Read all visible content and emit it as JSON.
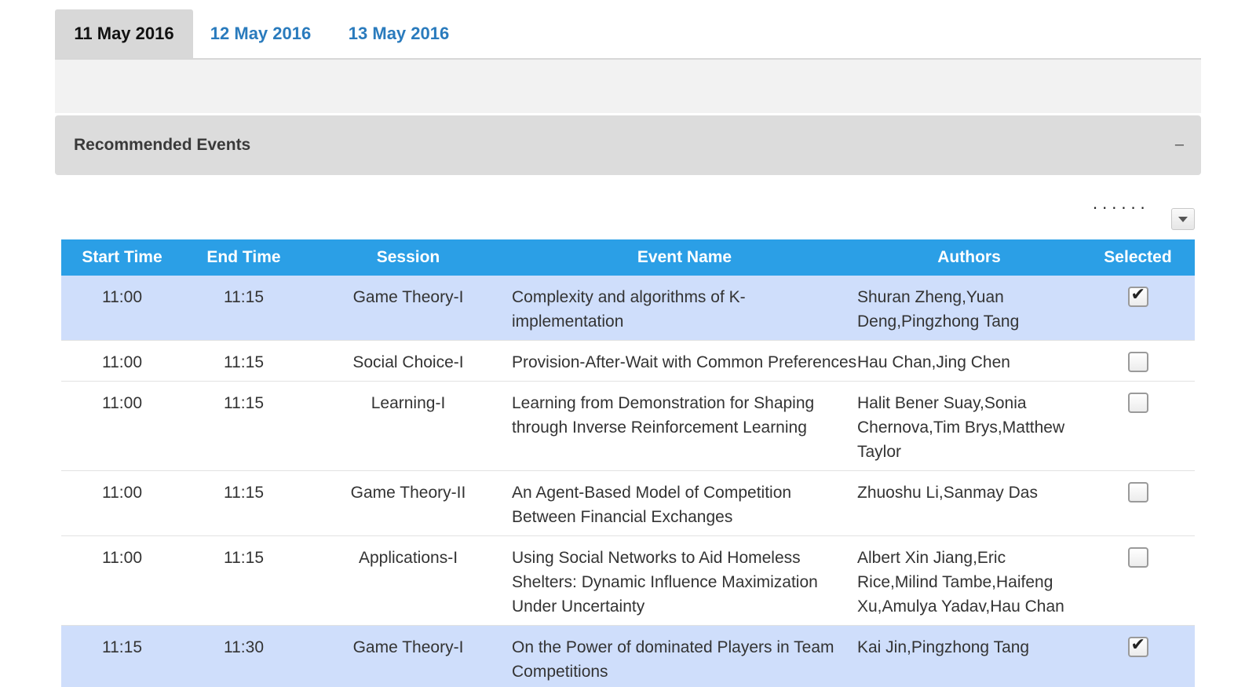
{
  "tabs": [
    {
      "label": "11 May 2016",
      "active": true
    },
    {
      "label": "12 May 2016",
      "active": false
    },
    {
      "label": "13 May 2016",
      "active": false
    }
  ],
  "panel": {
    "title": "Recommended Events",
    "collapse_symbol": "–",
    "more_symbol": "......"
  },
  "table": {
    "headers": {
      "start": "Start Time",
      "end": "End Time",
      "session": "Session",
      "event": "Event Name",
      "authors": "Authors",
      "selected": "Selected"
    },
    "rows": [
      {
        "start": "11:00",
        "end": "11:15",
        "session": "Game Theory-I",
        "event": "Complexity and algorithms of K-implementation",
        "authors": "Shuran Zheng,Yuan Deng,Pingzhong Tang",
        "selected": true
      },
      {
        "start": "11:00",
        "end": "11:15",
        "session": "Social Choice-I",
        "event": "Provision-After-Wait with Common Preferences",
        "authors": "Hau Chan,Jing Chen",
        "selected": false
      },
      {
        "start": "11:00",
        "end": "11:15",
        "session": "Learning-I",
        "event": "Learning from Demonstration for Shaping through Inverse Reinforcement Learning",
        "authors": "Halit Bener Suay,Sonia Chernova,Tim Brys,Matthew Taylor",
        "selected": false
      },
      {
        "start": "11:00",
        "end": "11:15",
        "session": "Game Theory-II",
        "event": "An Agent-Based Model of Competition Between Financial Exchanges",
        "authors": "Zhuoshu Li,Sanmay Das",
        "selected": false
      },
      {
        "start": "11:00",
        "end": "11:15",
        "session": "Applications-I",
        "event": "Using Social Networks to Aid Homeless Shelters: Dynamic Influence Maximization Under Uncertainty",
        "authors": "Albert Xin Jiang,Eric Rice,Milind Tambe,Haifeng Xu,Amulya Yadav,Hau Chan",
        "selected": false
      },
      {
        "start": "11:15",
        "end": "11:30",
        "session": "Game Theory-I",
        "event": "On the Power of dominated Players in Team Competitions",
        "authors": "Kai Jin,Pingzhong Tang",
        "selected": true
      }
    ]
  },
  "colors": {
    "header_blue": "#2b9fe6",
    "selected_row": "#cfdefb",
    "tab_link": "#2a7bbd"
  }
}
